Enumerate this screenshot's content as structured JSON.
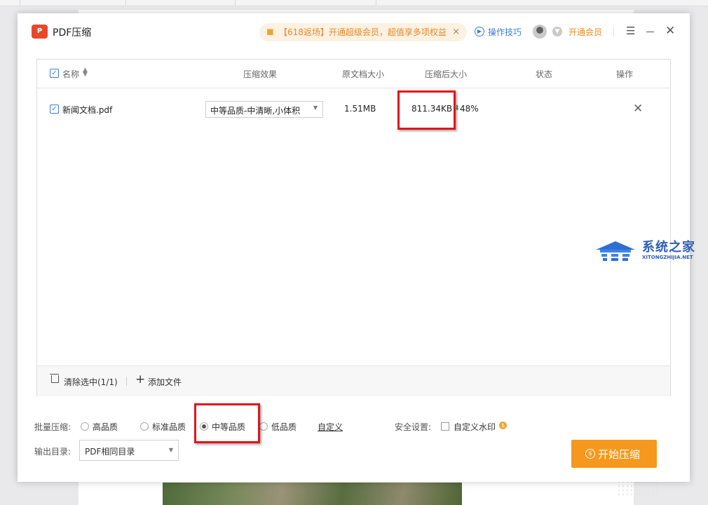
{
  "app": {
    "title": "PDF压缩",
    "logo_text": "P"
  },
  "promo": {
    "text": "【618返场】开通超级会员，超值享多项权益",
    "close": "×"
  },
  "header": {
    "tips": "操作技巧",
    "vip": "开通会员"
  },
  "table": {
    "columns": [
      "名称",
      "压缩效果",
      "原文档大小",
      "压缩后大小",
      "状态",
      "操作"
    ],
    "rows": [
      {
        "name": "新闻文档.pdf",
        "quality": "中等品质-中清晰,小体积",
        "orig_size": "1.51MB",
        "comp_size": "811.34KB",
        "ratio": "48%",
        "status": ""
      }
    ]
  },
  "footer": {
    "clear": "清除选中(1/1)",
    "add": "添加文件"
  },
  "batch": {
    "label": "批量压缩:",
    "options": [
      "高品质",
      "标准品质",
      "中等品质",
      "低品质"
    ],
    "selected": "中等品质",
    "custom": "自定义"
  },
  "security": {
    "label": "安全设置:",
    "watermark": "自定义水印"
  },
  "output": {
    "label": "输出目录:",
    "value": "PDF相同目录"
  },
  "start_button": "开始压缩",
  "watermark": {
    "cn": "系统之家",
    "en": "XITONGZHIJIA.NET"
  },
  "colors": {
    "accent": "#3a7be0",
    "orange": "#f5981d",
    "highlight": "#e3141b",
    "promo_bg": "#fdf1e1"
  }
}
